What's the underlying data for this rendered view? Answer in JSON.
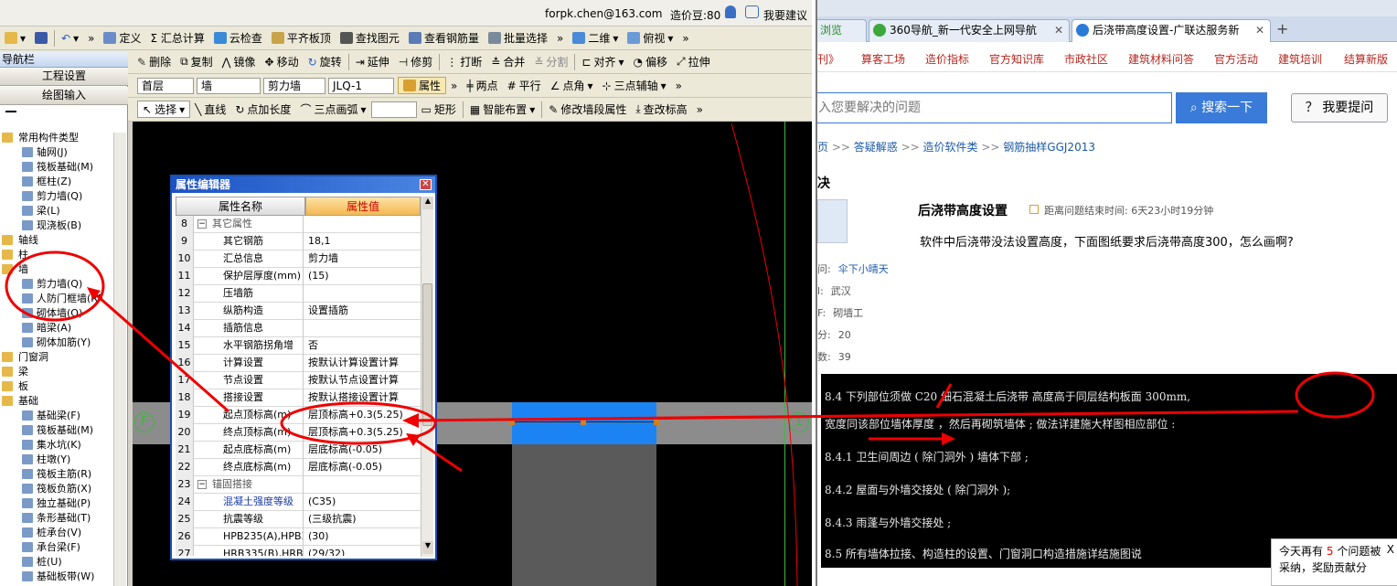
{
  "account": {
    "email": "forpk.chen@163.com",
    "bean": "造价豆:80",
    "suggest": "我要建议"
  },
  "toolbar1": {
    "items": [
      "定义",
      "Σ 汇总计算",
      "云检查",
      "平齐板顶",
      "查找图元",
      "查看钢筋量",
      "批量选择",
      "二维",
      "俯视"
    ]
  },
  "toolbar2": {
    "items": [
      "删除",
      "复制",
      "镜像",
      "移动",
      "旋转",
      "延伸",
      "修剪",
      "打断",
      "合并",
      "分割",
      "对齐",
      "偏移",
      "拉伸"
    ]
  },
  "toolbar3": {
    "floor": "首层",
    "type": "墙",
    "subtype": "剪力墙",
    "name": "JLQ-1",
    "attr": "属性",
    "items": [
      "两点",
      "平行",
      "点角",
      "三点辅轴"
    ]
  },
  "toolbar4": {
    "items": [
      "选择",
      "直线",
      "点加长度",
      "三点画弧",
      "矩形",
      "智能布置",
      "修改墙段属性",
      "查改标高"
    ]
  },
  "nav": {
    "title": "导航栏",
    "btn1": "工程设置",
    "btn2": "绘图输入",
    "tree": [
      {
        "label": "常用构件类型",
        "lvl": 0
      },
      {
        "label": "轴网(J)",
        "lvl": 1
      },
      {
        "label": "筏板基础(M)",
        "lvl": 1
      },
      {
        "label": "框柱(Z)",
        "lvl": 1
      },
      {
        "label": "剪力墙(Q)",
        "lvl": 1
      },
      {
        "label": "梁(L)",
        "lvl": 1
      },
      {
        "label": "现浇板(B)",
        "lvl": 1
      },
      {
        "label": "轴线",
        "lvl": 0
      },
      {
        "label": "柱",
        "lvl": 0
      },
      {
        "label": "墙",
        "lvl": 0
      },
      {
        "label": "剪力墙(Q)",
        "lvl": 1
      },
      {
        "label": "人防门框墙(RF",
        "lvl": 1
      },
      {
        "label": "砌体墙(Q)",
        "lvl": 1
      },
      {
        "label": "暗梁(A)",
        "lvl": 1
      },
      {
        "label": "砌体加筋(Y)",
        "lvl": 1
      },
      {
        "label": "门窗洞",
        "lvl": 0
      },
      {
        "label": "梁",
        "lvl": 0
      },
      {
        "label": "板",
        "lvl": 0
      },
      {
        "label": "基础",
        "lvl": 0
      },
      {
        "label": "基础梁(F)",
        "lvl": 1
      },
      {
        "label": "筏板基础(M)",
        "lvl": 1
      },
      {
        "label": "集水坑(K)",
        "lvl": 1
      },
      {
        "label": "柱墩(Y)",
        "lvl": 1
      },
      {
        "label": "筏板主筋(R)",
        "lvl": 1
      },
      {
        "label": "筏板负筋(X)",
        "lvl": 1
      },
      {
        "label": "独立基础(P)",
        "lvl": 1
      },
      {
        "label": "条形基础(T)",
        "lvl": 1
      },
      {
        "label": "桩承台(V)",
        "lvl": 1
      },
      {
        "label": "承台梁(F)",
        "lvl": 1
      },
      {
        "label": "桩(U)",
        "lvl": 1
      },
      {
        "label": "基础板带(W)",
        "lvl": 1
      }
    ]
  },
  "canvas": {
    "axis_left": "F",
    "axis_right": "1"
  },
  "prop_editor": {
    "title": "属性编辑器",
    "col_name": "属性名称",
    "col_value": "属性值",
    "rows": [
      {
        "n": "8",
        "name": "其它属性",
        "val": "",
        "group": true
      },
      {
        "n": "9",
        "name": "其它钢筋",
        "val": "18,1"
      },
      {
        "n": "10",
        "name": "汇总信息",
        "val": "剪力墙"
      },
      {
        "n": "11",
        "name": "保护层厚度(mm)",
        "val": "(15)"
      },
      {
        "n": "12",
        "name": "压墙筋",
        "val": ""
      },
      {
        "n": "13",
        "name": "纵筋构造",
        "val": "设置插筋"
      },
      {
        "n": "14",
        "name": "插筋信息",
        "val": ""
      },
      {
        "n": "15",
        "name": "水平钢筋拐角增",
        "val": "否"
      },
      {
        "n": "16",
        "name": "计算设置",
        "val": "按默认计算设置计算"
      },
      {
        "n": "17",
        "name": "节点设置",
        "val": "按默认节点设置计算"
      },
      {
        "n": "18",
        "name": "搭接设置",
        "val": "按默认搭接设置计算"
      },
      {
        "n": "19",
        "name": "起点顶标高(m)",
        "val": "层顶标高+0.3(5.25)"
      },
      {
        "n": "20",
        "name": "终点顶标高(m)",
        "val": "层顶标高+0.3(5.25)"
      },
      {
        "n": "21",
        "name": "起点底标高(m)",
        "val": "层底标高(-0.05)"
      },
      {
        "n": "22",
        "name": "终点底标高(m)",
        "val": "层底标高(-0.05)"
      },
      {
        "n": "23",
        "name": "锚固搭接",
        "val": "",
        "group": true
      },
      {
        "n": "24",
        "name": "混凝土强度等级",
        "val": "(C35)"
      },
      {
        "n": "25",
        "name": "抗震等级",
        "val": "(三级抗震)"
      },
      {
        "n": "26",
        "name": "HPB235(A),HPB3",
        "val": "(30)"
      },
      {
        "n": "27",
        "name": "HRB335(B),HRB3",
        "val": "(29/32)"
      }
    ]
  },
  "browser": {
    "tab0": "浏览",
    "tab1": "360导航_新一代安全上网导航",
    "tab2": "后浇带高度设置-广联达服务新",
    "nav_links": [
      "刊》",
      "算客工场",
      "造价指标",
      "官方知识库",
      "市政社区",
      "建筑材料问答",
      "官方活动",
      "建筑培训",
      "结算新版"
    ],
    "search_placeholder": "入您要解决的问题",
    "search_btn": "搜索一下",
    "ask_btn": "我要提问",
    "crumb": [
      "页",
      "答疑解惑",
      "造价软件类",
      "钢筋抽样GGJ2013"
    ],
    "section": "决",
    "q_title": "后浇带高度设置",
    "q_timer": "距离问题结束时间:  6天23小时19分钟",
    "q_body": "软件中后浇带没法设置高度，下面图纸要求后浇带高度300，怎么画啊?",
    "meta": [
      {
        "k": "问:",
        "v": "伞下小晴天"
      },
      {
        "k": "l:",
        "v": "武汉"
      },
      {
        "k": "F:",
        "v": "砌墙工"
      },
      {
        "k": "分:",
        "v": "20"
      },
      {
        "k": "数:",
        "v": "39"
      }
    ],
    "doc_lines": [
      {
        "t": "8.4    下列部位须做        C20  细石混凝土后浇带                 高度高于同层结构板面              300mm,"
      },
      {
        "t": "       宽度同该部位墙体厚度               ，然后再砌筑墙体           ;   做法详建施大样图相应部位                 :"
      },
      {
        "t": "       8.4.1      卫生间周边        ( 除门洞外     ) 墙体下部       ;"
      },
      {
        "t": "       8.4.2      屋面与外墙交接处              ( 除门洞外       );"
      },
      {
        "t": "       8.4.3      雨蓬与外墙交接处                   ;"
      },
      {
        "t": "8.5    所有墙体拉接、构造柱的设置、门窗洞口构造措施详结施图说"
      }
    ],
    "popup_text1": "今天再有",
    "popup_num": "5",
    "popup_text2": "个问题被",
    "popup_line2": "采纳，奖励贡献分",
    "popup_close": "X"
  }
}
